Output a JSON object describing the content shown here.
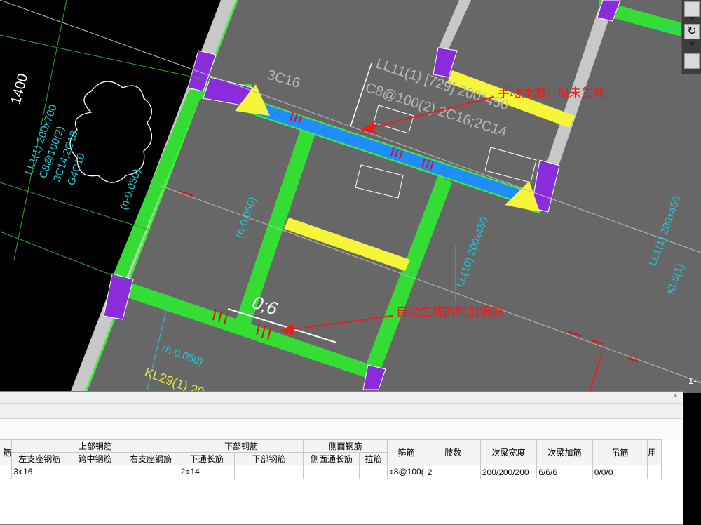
{
  "cad": {
    "labels": {
      "dim_1400": "1400",
      "beam_3c16": "3C16",
      "beam_ll11_a": "LL11(1) [729] 200*450",
      "beam_ll11_b": "C8@100(2) 2C16;2C14",
      "left_beam_a": "LL1(1) 200x700",
      "left_beam_b": "C8@100(2)",
      "left_beam_c": "3C14;2C18",
      "left_beam_d": "G4C10",
      "left_beam_e": "(h-0.050)",
      "mid_label": "(h-0.050)",
      "right_beam": "LL(10) 200x450",
      "kl29_a": "(h-0.050)",
      "kl29_b": "KL29(1) 20",
      "marker_06": "0;6",
      "right_ll": "LL1(1) 200x450",
      "right_kl": "KL5(1)"
    },
    "annotations": {
      "manual_added": "手动添加，但未生成",
      "auto_generated": "自动生成的附加钢筋"
    }
  },
  "toolbar": {
    "side_label": "1-"
  },
  "panel": {
    "close_label": "×",
    "group_headers": [
      {
        "key": "col0",
        "label": "筋"
      },
      {
        "key": "top",
        "label": "上部钢筋"
      },
      {
        "key": "bottom",
        "label": "下部钢筋"
      },
      {
        "key": "side",
        "label": "侧面钢筋"
      },
      {
        "key": "stirrup",
        "label": "箍筋"
      },
      {
        "key": "legs",
        "label": "肢数"
      },
      {
        "key": "width",
        "label": "次梁宽度"
      },
      {
        "key": "extra",
        "label": "次梁加筋"
      },
      {
        "key": "hanger",
        "label": "吊筋"
      },
      {
        "key": "more",
        "label": "用"
      }
    ],
    "sub_headers": [
      "左支座钢筋",
      "跨中钢筋",
      "右支座钢筋",
      "下通长筋",
      "下部钢筋",
      "侧面通长筋",
      "拉筋"
    ],
    "row": {
      "col0": "",
      "left_support": "3⌽16",
      "mid_span": "",
      "right_support": "",
      "bottom_through": "2⌽14",
      "bottom": "",
      "side_through": "",
      "tie": "",
      "stirrup": "⌽8@100(",
      "legs": "2",
      "width": "200/200/200",
      "extra": "6/6/6",
      "hanger": "0/0/0",
      "more": ""
    }
  }
}
